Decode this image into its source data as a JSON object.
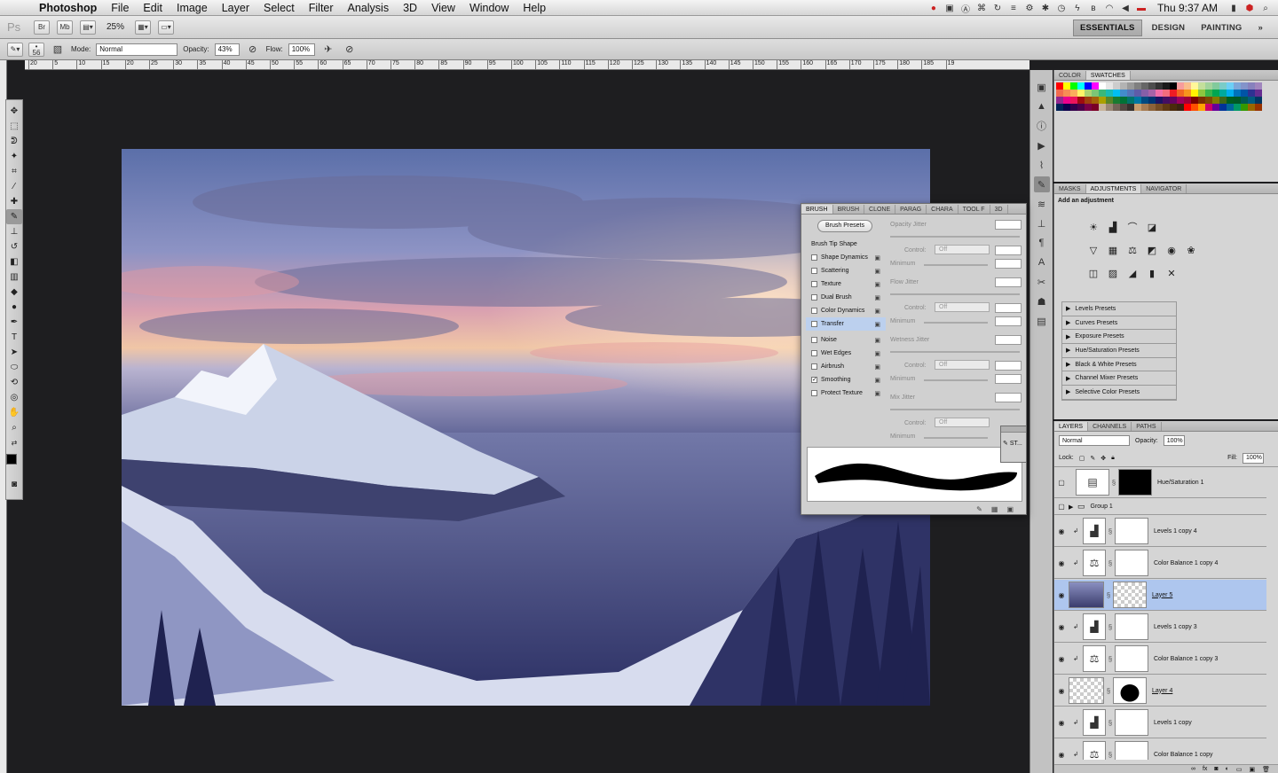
{
  "menubar": {
    "app_name": "Photoshop",
    "menus": [
      "File",
      "Edit",
      "Image",
      "Layer",
      "Select",
      "Filter",
      "Analysis",
      "3D",
      "View",
      "Window",
      "Help"
    ],
    "clock": "Thu 9:37 AM"
  },
  "appbar": {
    "ps_badge": "Ps",
    "br_label": "Br",
    "mb_label": "Mb",
    "zoom": "25%",
    "workspaces": [
      "ESSENTIALS",
      "DESIGN",
      "PAINTING"
    ],
    "workspace_more": "»"
  },
  "options": {
    "brush_size": "56",
    "mode_label": "Mode:",
    "mode_value": "Normal",
    "opacity_label": "Opacity:",
    "opacity_value": "43%",
    "flow_label": "Flow:",
    "flow_value": "100%"
  },
  "ruler": {
    "ticks": [
      "20",
      "5",
      "10",
      "15",
      "20",
      "25",
      "30",
      "35",
      "40",
      "45",
      "50",
      "55",
      "60",
      "65",
      "70",
      "75",
      "80",
      "85",
      "90",
      "95",
      "100",
      "105",
      "110",
      "115",
      "120",
      "125",
      "130",
      "135",
      "140",
      "145",
      "150",
      "155",
      "160",
      "165",
      "170",
      "175",
      "180",
      "185",
      "19"
    ]
  },
  "swatches_panel": {
    "tabs": [
      "COLOR",
      "SWATCHES"
    ]
  },
  "adjustments_panel": {
    "tabs": [
      "MASKS",
      "ADJUSTMENTS",
      "NAVIGATOR"
    ],
    "title": "Add an adjustment",
    "presets": [
      "Levels Presets",
      "Curves Presets",
      "Exposure Presets",
      "Hue/Saturation Presets",
      "Black & White Presets",
      "Channel Mixer Presets",
      "Selective Color Presets"
    ]
  },
  "layers_panel": {
    "tabs": [
      "LAYERS",
      "CHANNELS",
      "PATHS"
    ],
    "blend_mode": "Normal",
    "opacity_label": "Opacity:",
    "opacity_value": "100%",
    "lock_label": "Lock:",
    "fill_label": "Fill:",
    "fill_value": "100%",
    "layers": [
      {
        "name": "Hue/Saturation 1"
      },
      {
        "name": "Group 1"
      },
      {
        "name": "Levels 1 copy 4"
      },
      {
        "name": "Color Balance 1 copy 4"
      },
      {
        "name": "Layer 5"
      },
      {
        "name": "Levels 1 copy 3"
      },
      {
        "name": "Color Balance 1 copy 3"
      },
      {
        "name": "Layer 4"
      },
      {
        "name": "Levels 1 copy"
      },
      {
        "name": "Color Balance 1 copy"
      }
    ]
  },
  "brush_panel": {
    "tabs": [
      "BRUSH",
      "BRUSH",
      "CLONE",
      "PARAG",
      "CHARA",
      "TOOL F",
      "3D"
    ],
    "presets_button": "Brush Presets",
    "options": [
      "Brush Tip Shape",
      "Shape Dynamics",
      "Scattering",
      "Texture",
      "Dual Brush",
      "Color Dynamics",
      "Transfer",
      "Noise",
      "Wet Edges",
      "Airbrush",
      "Smoothing",
      "Protect Texture"
    ],
    "right": {
      "opacity_jitter": "Opacity Jitter",
      "control": "Control:",
      "off": "Off",
      "minimum": "Minimum",
      "flow_jitter": "Flow Jitter",
      "wetness_jitter": "Wetness Jitter",
      "mix_jitter": "Mix Jitter"
    },
    "float_label": "ST..."
  },
  "colors": {
    "selection": "#aec6ee",
    "panel": "#d5d5d5",
    "canvas_bg": "#1e1e20"
  }
}
